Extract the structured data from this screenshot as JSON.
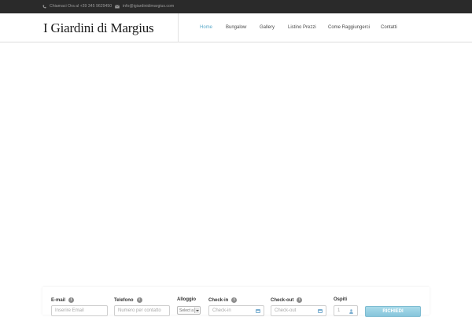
{
  "topbar": {
    "phone_text": "Chiamaci Ora al +39 345 9629450",
    "email_text": "info@igiardinidimargius.com"
  },
  "header": {
    "logo": "I Giardini di Margius",
    "nav": [
      "Home",
      "Bungalow",
      "Gallery",
      "Listino Prezzi",
      "Come Raggiungerci",
      "Contatti"
    ],
    "active_nav": "Home"
  },
  "booking": {
    "email_label": "E-mail",
    "email_placeholder": "Inserire Email",
    "phone_label": "Telefono",
    "phone_placeholder": "Numero per contatto",
    "accommodation_label": "Alloggio",
    "accommodation_selected": "Select a",
    "checkin_label": "Check-in",
    "checkin_placeholder": "Check-in",
    "checkout_label": "Check-out",
    "checkout_placeholder": "Check-out",
    "guests_label": "Ospiti",
    "guests_value": "1",
    "submit_label": "RICHIEDI"
  },
  "colors": {
    "topbar_bg": "#2a2a2a",
    "accent": "#5aa9c9",
    "button": "#86c5db"
  }
}
